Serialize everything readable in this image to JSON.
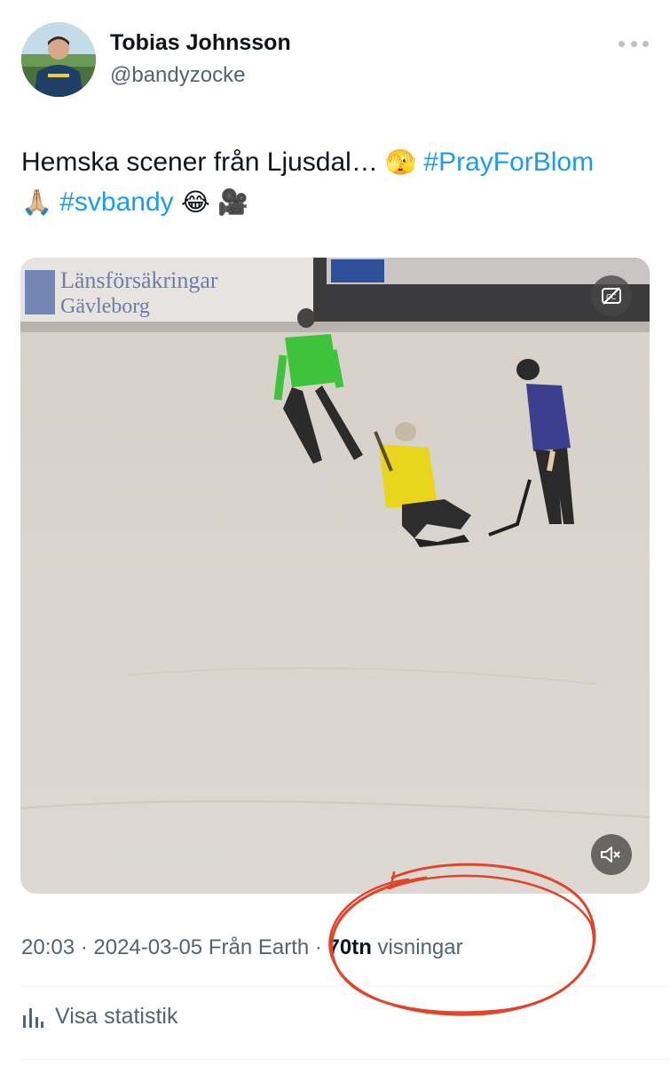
{
  "author": {
    "display_name": "Tobias Johnsson",
    "handle": "@bandyzocke",
    "avatar_icon": "profile-photo"
  },
  "tweet": {
    "text_parts": {
      "intro": "Hemska scener från Ljusdal… ",
      "emoji_1": "🫣",
      "hashtag_1": "#PrayForBlom",
      "emoji_2": "🙏🏼",
      "hashtag_2": "#svbandy",
      "emoji_3": "😂",
      "emoji_4": "🎥"
    },
    "hashtag_color": "#1d9bf0"
  },
  "media": {
    "type": "video",
    "banner_text_1": "Länsförsäkringar",
    "banner_text_2": "Gävleborg",
    "controls": {
      "captions_icon": "closed-captions-off-icon",
      "mute_icon": "muted-speaker-icon"
    }
  },
  "meta": {
    "time": "20:03",
    "sep_1": " · ",
    "date": "2024-03-05",
    "source": " Från Earth",
    "sep_2": " · ",
    "views_count": "70tn",
    "views_label": " visningar"
  },
  "stats": {
    "label": "Visa statistik",
    "icon": "bar-chart-icon"
  },
  "annotation": {
    "color": "#e0442b",
    "shape": "hand-drawn-circle"
  }
}
